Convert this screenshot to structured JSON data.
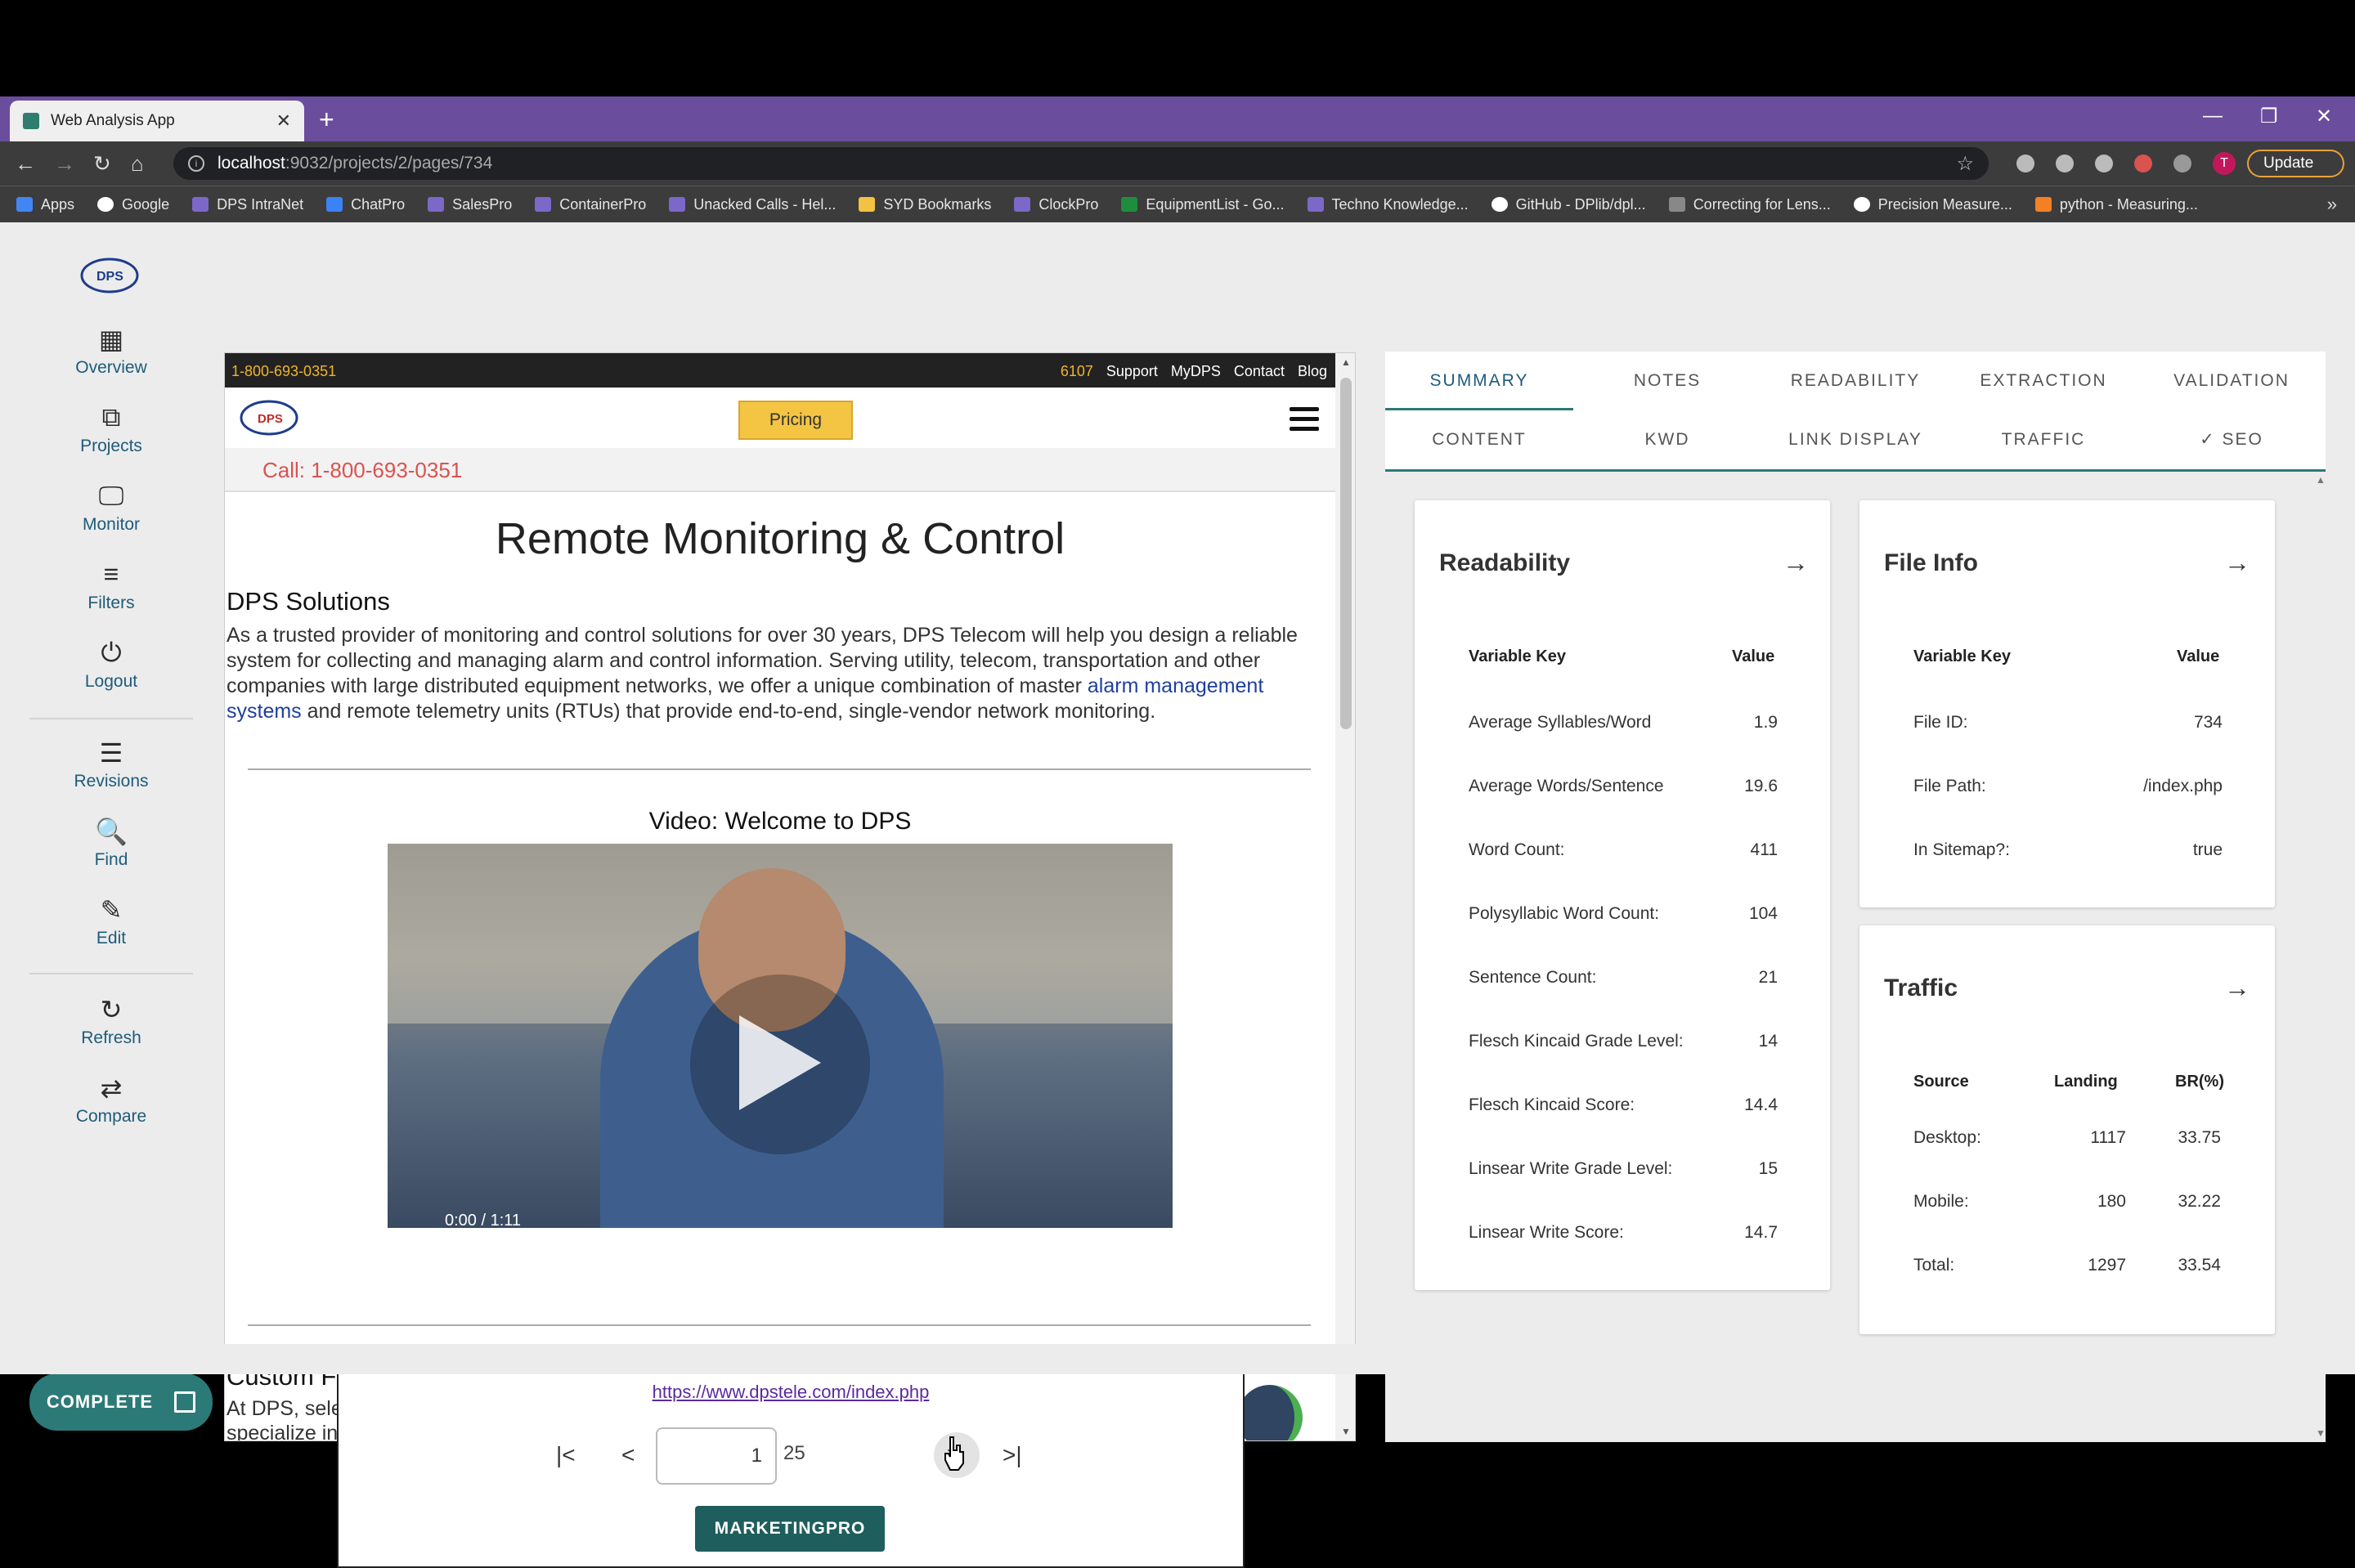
{
  "browser": {
    "tab_title": "Web Analysis App",
    "url_host": "localhost",
    "url_rest": ":9032/projects/2/pages/734",
    "update_label": "Update",
    "avatar_letter": "T",
    "bookmarks": [
      "Apps",
      "Google",
      "DPS IntraNet",
      "ChatPro",
      "SalesPro",
      "ContainerPro",
      "Unacked Calls - Hel...",
      "SYD Bookmarks",
      "ClockPro",
      "EquipmentList - Go...",
      "Techno Knowledge...",
      "GitHub - DPlib/dpl...",
      "Correcting for Lens...",
      "Precision Measure...",
      "python - Measuring..."
    ]
  },
  "sidebar": {
    "overview": "Overview",
    "projects": "Projects",
    "monitor": "Monitor",
    "filters": "Filters",
    "logout": "Logout",
    "revisions": "Revisions",
    "find": "Find",
    "edit": "Edit",
    "refresh": "Refresh",
    "compare": "Compare",
    "complete": "COMPLETE"
  },
  "preview": {
    "phone_top": "1-800-693-0351",
    "top_num": "6107",
    "top_links": [
      "Support",
      "MyDPS",
      "Contact",
      "Blog"
    ],
    "pricing": "Pricing",
    "call": "Call: 1-800-693-0351",
    "h1": "Remote Monitoring & Control",
    "h2": "DPS Solutions",
    "p_before": "As a trusted provider of monitoring and control solutions for over 30 years, DPS Telecom will help you design a reliable system for collecting and managing alarm and control information. Serving utility, telecom, transportation and other companies with large distributed equipment networks, we offer a unique combination of master ",
    "p_link": "alarm management systems",
    "p_after": " and remote telemetry units (RTUs) that provide end-to-end, single-vendor network monitoring.",
    "video_heading": "Video: Welcome to DPS",
    "video_time": "0:00 / 1:11",
    "h3": "Custom Fi",
    "p2_line1": "At DPS, sele",
    "p2_line2": "specialize in"
  },
  "pager": {
    "link": "https://www.dpstele.com/index.php",
    "current_page": "1",
    "total": "25",
    "button": "MARKETINGPRO"
  },
  "tabs": {
    "row1": [
      "SUMMARY",
      "NOTES",
      "READABILITY",
      "EXTRACTION",
      "VALIDATION"
    ],
    "row2": [
      "CONTENT",
      "KWD",
      "LINK DISPLAY",
      "TRAFFIC",
      "✓  SEO"
    ]
  },
  "readability": {
    "title": "Readability",
    "col_key": "Variable Key",
    "col_value": "Value",
    "rows": [
      {
        "key": "Average Syllables/Word",
        "value": "1.9"
      },
      {
        "key": "Average Words/Sentence",
        "value": "19.6"
      },
      {
        "key": "Word Count:",
        "value": "411"
      },
      {
        "key": "Polysyllabic Word Count:",
        "value": "104"
      },
      {
        "key": "Sentence Count:",
        "value": "21"
      },
      {
        "key": "Flesch Kincaid Grade Level:",
        "value": "14"
      },
      {
        "key": "Flesch Kincaid Score:",
        "value": "14.4"
      },
      {
        "key": "Linsear Write Grade Level:",
        "value": "15"
      },
      {
        "key": "Linsear Write Score:",
        "value": "14.7"
      }
    ]
  },
  "file_info": {
    "title": "File Info",
    "col_key": "Variable Key",
    "col_value": "Value",
    "rows": [
      {
        "key": "File ID:",
        "value": "734"
      },
      {
        "key": "File Path:",
        "value": "/index.php"
      },
      {
        "key": "In Sitemap?:",
        "value": "true"
      }
    ]
  },
  "traffic": {
    "title": "Traffic",
    "cols": [
      "Source",
      "Landing",
      "BR(%)"
    ],
    "rows": [
      {
        "source": "Desktop:",
        "landing": "1117",
        "br": "33.75"
      },
      {
        "source": "Mobile:",
        "landing": "180",
        "br": "32.22"
      },
      {
        "source": "Total:",
        "landing": "1297",
        "br": "33.54"
      }
    ]
  },
  "colors": {
    "accent": "#2c7a78",
    "tabbar": "#6b4d9e",
    "pricing": "#f4c542"
  }
}
